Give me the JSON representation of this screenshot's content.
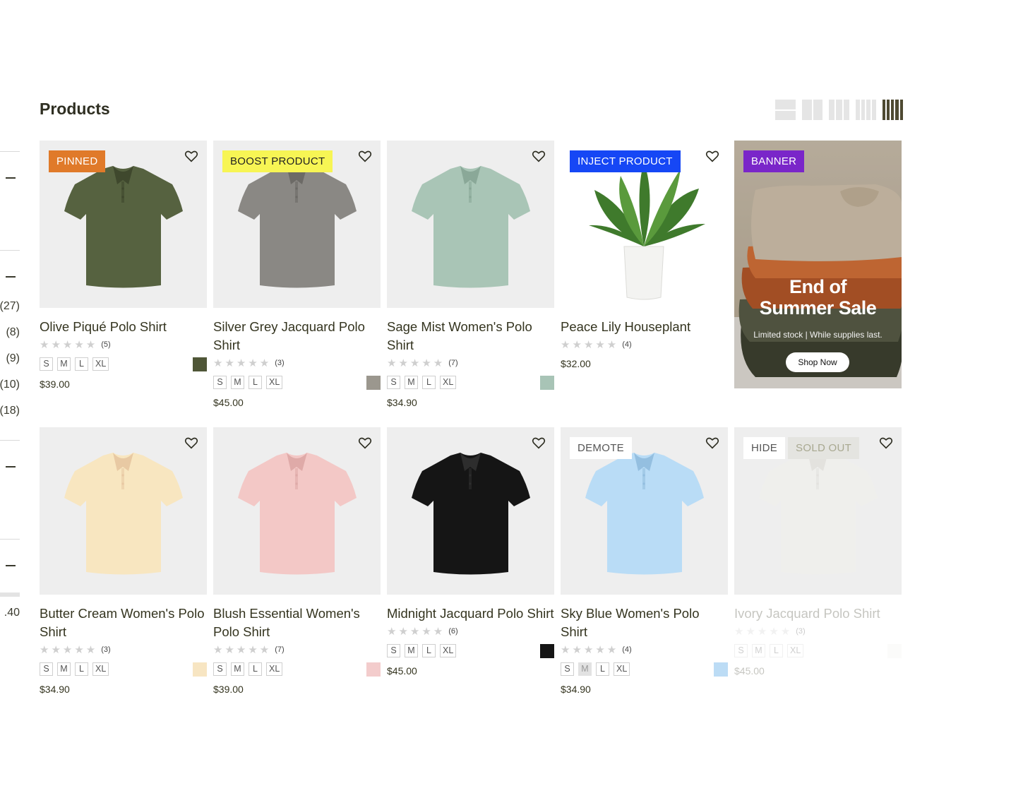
{
  "page": {
    "title": "Products"
  },
  "sidebar": {
    "counts": [
      "(27)",
      "(8)",
      "(9)",
      "(10)",
      "(18)"
    ],
    "price_fragment": ".40"
  },
  "view_toggle": {
    "options": [
      "1-column",
      "2-column",
      "3-column",
      "4-column",
      "5-column"
    ],
    "active": "5-column"
  },
  "products": [
    {
      "badges": [
        {
          "text": "PINNED",
          "bg": "#e07a2a",
          "color": "#ffffff"
        }
      ],
      "image": "olive-polo-shirt",
      "title": "Olive Piqué Polo Shirt",
      "stars": "★★★★★",
      "reviews": "(5)",
      "sizes": [
        "S",
        "M",
        "L",
        "XL"
      ],
      "swatch": "#4f5637",
      "price": "$39.00"
    },
    {
      "badges": [
        {
          "text": "BOOST PRODUCT",
          "bg": "#f7f554",
          "color": "#222222"
        }
      ],
      "image": "grey-polo-shirt",
      "title": "Silver Grey Jacquard Polo Shirt",
      "stars": "★★★★★",
      "reviews": "(3)",
      "sizes": [
        "S",
        "M",
        "L",
        "XL"
      ],
      "swatch": "#9b978e",
      "price": "$45.00"
    },
    {
      "badges": [],
      "image": "sage-polo-shirt",
      "title": "Sage Mist Women's Polo Shirt",
      "stars": "★★★★★",
      "reviews": "(7)",
      "sizes": [
        "S",
        "M",
        "L",
        "XL"
      ],
      "swatch": "#a8c4b6",
      "price": "$34.90"
    },
    {
      "badges": [
        {
          "text": "INJECT PRODUCT",
          "bg": "#1647f5",
          "color": "#ffffff"
        }
      ],
      "image": "peace-lily-plant",
      "title": "Peace Lily Houseplant",
      "stars": "★★★★★",
      "reviews": "(4)",
      "sizes": [],
      "swatch": "",
      "price": "$32.00"
    },
    {
      "badges": [],
      "image": "butter-polo-shirt",
      "title": "Butter Cream Women's Polo Shirt",
      "stars": "★★★★★",
      "reviews": "(3)",
      "sizes": [
        "S",
        "M",
        "L",
        "XL"
      ],
      "swatch": "#f7e5c2",
      "price": "$34.90"
    },
    {
      "badges": [],
      "image": "blush-polo-shirt",
      "title": "Blush Essential Women's Polo Shirt",
      "stars": "★★★★★",
      "reviews": "(7)",
      "sizes": [
        "S",
        "M",
        "L",
        "XL"
      ],
      "swatch": "#f3cccc",
      "price": "$39.00"
    },
    {
      "badges": [],
      "image": "black-polo-shirt",
      "title": "Midnight Jacquard Polo Shirt",
      "stars": "★★★★★",
      "reviews": "(6)",
      "sizes": [
        "S",
        "M",
        "L",
        "XL"
      ],
      "swatch": "#151515",
      "price": "$45.00"
    },
    {
      "badges": [
        {
          "text": "DEMOTE",
          "bg": "#ffffff",
          "color": "#555555"
        }
      ],
      "image": "skyblue-polo-shirt",
      "title": "Sky Blue Women's Polo Shirt",
      "stars": "★★★★★",
      "reviews": "(4)",
      "sizes": [
        "S",
        "M",
        "L",
        "XL"
      ],
      "unavailable_sizes": [
        "M"
      ],
      "swatch": "#bcdcf5",
      "price": "$34.90"
    },
    {
      "badges": [
        {
          "text": "HIDE",
          "bg": "#ffffff",
          "color": "#555555"
        },
        {
          "text": "SOLD OUT",
          "bg": "#e4e4e0",
          "color": "#a8a890"
        }
      ],
      "image": "ivory-polo-shirt",
      "title": "Ivory Jacquard Polo Shirt",
      "stars": "★★★★★",
      "reviews": "(3)",
      "sizes": [
        "S",
        "M",
        "L",
        "XL"
      ],
      "swatch": "#f2f2ee",
      "price": "$45.00",
      "faded": true
    }
  ],
  "banner": {
    "badge": "BANNER",
    "badge_bg": "#7a26c9",
    "headline_line1": "End of",
    "headline_line2": "Summer Sale",
    "subtext": "Limited stock | While supplies last.",
    "cta": "Shop Now"
  }
}
